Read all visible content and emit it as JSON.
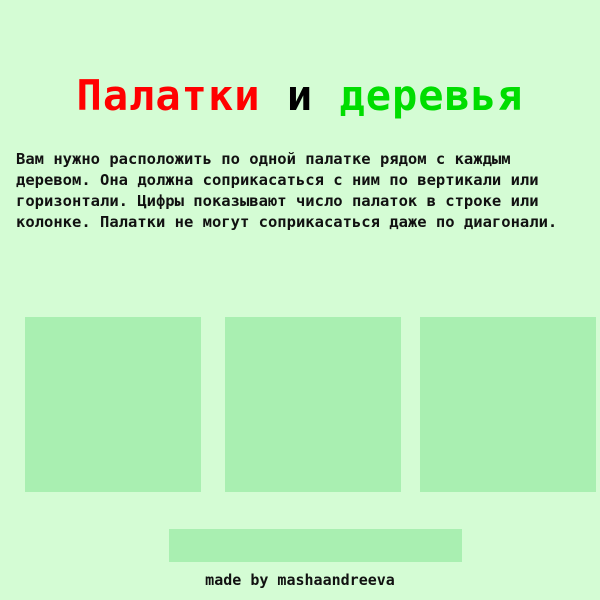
{
  "title": {
    "word1": "Палатки",
    "word2": "и",
    "word3": "деревья",
    "colors": {
      "word1": "#ff0000",
      "word2": "#000000",
      "word3": "#00dd00"
    }
  },
  "instructions": "Вам нужно расположить по одной палатке рядом с каждым деревом. Она должна соприкасаться с ним по вертикали или горизонтали. Цифры показывают число палаток в строке или колонке. Палатки не могут соприкасаться даже по диагонали.",
  "levels": [
    "",
    "",
    ""
  ],
  "bottom_button": "",
  "credit": "made by mashaandreeva",
  "colors": {
    "background": "#d4fcd4",
    "tile": "#a9efb1"
  }
}
